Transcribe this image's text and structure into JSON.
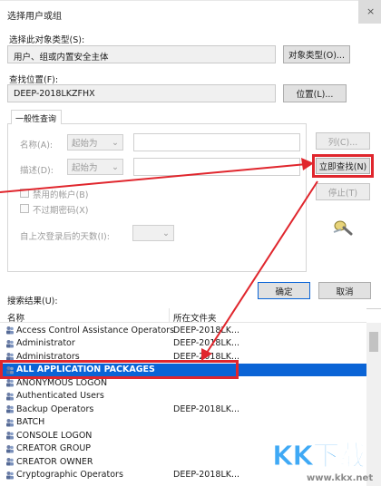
{
  "window": {
    "title": "选择用户或组",
    "close_glyph": "×"
  },
  "object_type": {
    "label": "选择此对象类型(S):",
    "value": "用户、组或内置安全主体",
    "button": "对象类型(O)..."
  },
  "location": {
    "label": "查找位置(F):",
    "value": "DEEP-2018LKZFHX",
    "button": "位置(L)..."
  },
  "general_query": {
    "tab": "一般性查询",
    "name_label": "名称(A):",
    "desc_label": "描述(D):",
    "starts_with": "起始为",
    "disabled_accounts": "禁用的帐户(B)",
    "non_expiring_pw": "不过期密码(X)",
    "days_since_logon": "自上次登录后的天数(I):"
  },
  "buttons": {
    "columns": "列(C)...",
    "find_now": "立即查找(N)",
    "stop": "停止(T)",
    "ok": "确定",
    "cancel": "取消"
  },
  "results": {
    "label": "搜索结果(U):",
    "col_name": "名称",
    "col_folder": "所在文件夹",
    "rows": [
      {
        "name": "Access Control Assistance Operators",
        "folder": "DEEP-2018LK..."
      },
      {
        "name": "Administrator",
        "folder": "DEEP-2018LK..."
      },
      {
        "name": "Administrators",
        "folder": "DEEP-2018LK..."
      },
      {
        "name": "ALL APPLICATION PACKAGES",
        "folder": ""
      },
      {
        "name": "ANONYMOUS LOGON",
        "folder": ""
      },
      {
        "name": "Authenticated Users",
        "folder": ""
      },
      {
        "name": "Backup Operators",
        "folder": "DEEP-2018LK..."
      },
      {
        "name": "BATCH",
        "folder": ""
      },
      {
        "name": "CONSOLE LOGON",
        "folder": ""
      },
      {
        "name": "CREATOR GROUP",
        "folder": ""
      },
      {
        "name": "CREATOR OWNER",
        "folder": ""
      },
      {
        "name": "Cryptographic Operators",
        "folder": "DEEP-2018LK..."
      }
    ]
  },
  "watermark": {
    "brand": "KK下载",
    "url": "www.kkx.net"
  },
  "colors": {
    "highlight": "#e0262d",
    "selection": "#0a64d6",
    "watermark": "#3fa9f5"
  }
}
